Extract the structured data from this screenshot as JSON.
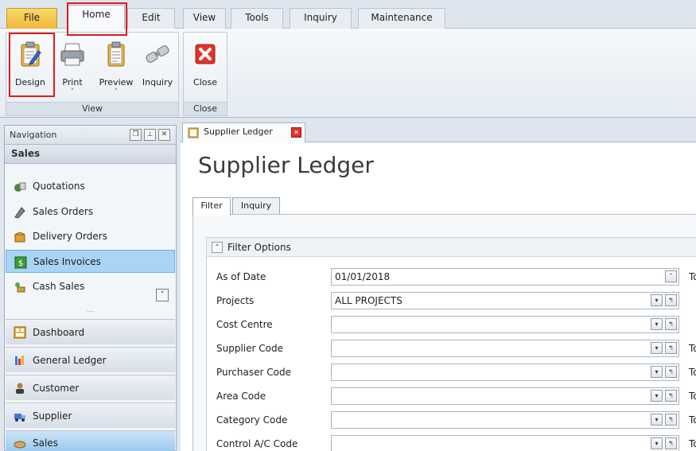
{
  "ribbon": {
    "tabs": [
      "File",
      "Home",
      "Edit",
      "View",
      "Tools",
      "Inquiry",
      "Maintenance"
    ],
    "active_tab": "Home",
    "groups": {
      "view": {
        "caption": "View",
        "buttons": {
          "design": "Design",
          "print": "Print",
          "preview": "Preview",
          "inquiry": "Inquiry"
        }
      },
      "close": {
        "caption": "Close",
        "buttons": {
          "close": "Close"
        }
      }
    },
    "icons": {
      "design": "clipboard-pencil-icon",
      "print": "printer-icon",
      "preview": "document-preview-icon",
      "inquiry": "binoculars-icon",
      "close": "red-x-close-icon"
    }
  },
  "navigation": {
    "title": "Navigation",
    "section_header": "Sales",
    "items": [
      "Quotations",
      "Sales Orders",
      "Delivery Orders",
      "Sales Invoices",
      "Cash Sales"
    ],
    "selected_item": "Sales Invoices",
    "modules": [
      "Dashboard",
      "General Ledger",
      "Customer",
      "Supplier",
      "Sales"
    ],
    "selected_module": "Sales"
  },
  "document": {
    "tab_label": "Supplier Ledger",
    "page_title": "Supplier Ledger",
    "inner_tabs": [
      "Filter",
      "Inquiry"
    ],
    "active_inner_tab": "Filter",
    "filter_title": "Filter Options",
    "to_label": "To",
    "fields": [
      {
        "label": "As of Date",
        "value": "01/01/2018"
      },
      {
        "label": "Projects",
        "value": "ALL PROJECTS"
      },
      {
        "label": "Cost Centre",
        "value": ""
      },
      {
        "label": "Supplier Code",
        "value": ""
      },
      {
        "label": "Purchaser Code",
        "value": ""
      },
      {
        "label": "Area Code",
        "value": ""
      },
      {
        "label": "Category Code",
        "value": ""
      },
      {
        "label": "Control A/C Code",
        "value": ""
      }
    ]
  },
  "colors": {
    "file_tab": "#f1b83a",
    "highlight": "#e11b1b",
    "selection": "#a9d4f6"
  }
}
